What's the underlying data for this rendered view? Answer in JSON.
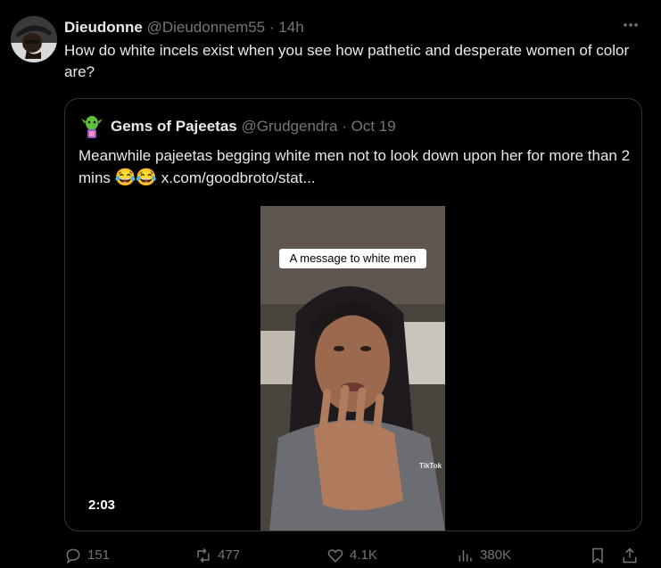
{
  "tweet": {
    "author_name": "Dieudonne",
    "author_handle": "@Dieudonnem55",
    "separator": "·",
    "time": "14h",
    "text": "How do white incels exist when you see how pathetic and desperate women of color are?"
  },
  "quoted_tweet": {
    "author_name": "Gems of Pajeetas",
    "author_handle": "@Grudgendra",
    "separator": "·",
    "date": "Oct 19",
    "text": "Meanwhile pajeetas begging white men not to look down upon her for more than 2 mins",
    "emoji": "😂😂",
    "link_text": "x.com/goodbroto/stat...",
    "video": {
      "caption": "A message to white men",
      "watermark": "TikTok",
      "duration": "2:03"
    }
  },
  "actions": {
    "replies": "151",
    "reposts": "477",
    "likes": "4.1K",
    "views": "380K"
  },
  "icons": {
    "more": "more-horizontal-icon",
    "reply": "reply-icon",
    "repost": "repost-icon",
    "like": "heart-icon",
    "views": "views-chart-icon",
    "bookmark": "bookmark-icon",
    "share": "share-icon"
  },
  "colors": {
    "background": "#000000",
    "text": "#e7e9ea",
    "muted": "#71767b",
    "border": "#2f3336"
  }
}
